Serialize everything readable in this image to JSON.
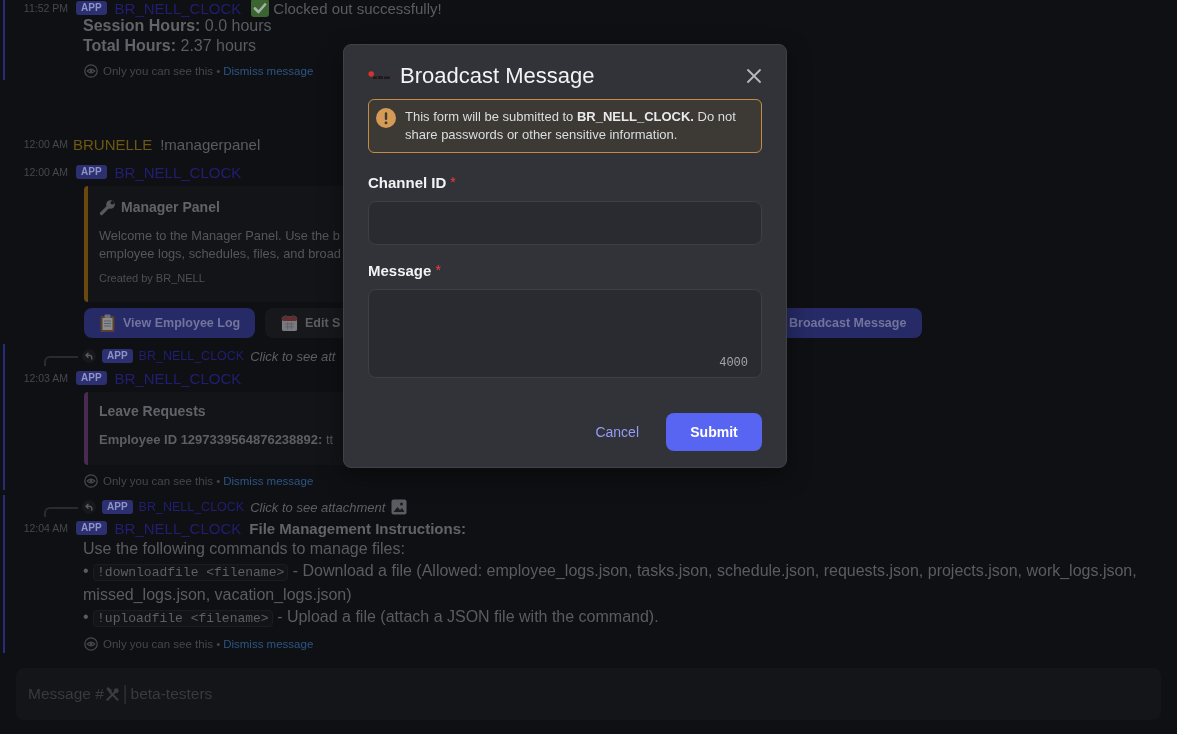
{
  "messages": [
    {
      "kind": "app",
      "ephemeral": true,
      "time": "11:52 PM",
      "badge": "APP",
      "author": "BR_NELL_CLOCK",
      "text": "Clocked out successfully!",
      "lines": [
        {
          "kind": "text",
          "text": "**Session Hours:** 0.0 hours"
        },
        {
          "kind": "text",
          "text": "**Total Hours:** 2.37 hours"
        }
      ],
      "note": {
        "text": "Only you can see this •",
        "link": "Dismiss message"
      }
    },
    {
      "kind": "user",
      "ephemeral": false,
      "time": "12:00 AM",
      "author": "BRUNELLE",
      "text": "!managerpanel"
    },
    {
      "kind": "app",
      "ephemeral": false,
      "time": "12:00 AM",
      "badge": "APP",
      "author": "BR_NELL_CLOCK",
      "embed": {
        "color": "#6b480e",
        "title": "Manager Panel",
        "description": [
          "Welcome to the Manager Panel. Use the b",
          "employee logs, schedules, files, and broad"
        ],
        "footer": "Created by BR_NELL"
      },
      "buttons": [
        {
          "label": "View Employee Log",
          "kind": "primary"
        },
        {
          "label": "Edit S",
          "kind": "secondary"
        },
        {
          "label": "Broadcast Message",
          "kind": "primary"
        }
      ]
    },
    {
      "kind": "app",
      "ephemeral": true,
      "reply": {
        "badge": "APP",
        "author": "BR_NELL_CLOCK",
        "text": "Click to see att"
      },
      "time": "12:03 AM",
      "badge": "APP",
      "author": "BR_NELL_CLOCK",
      "embed": {
        "color": "#4a2953",
        "title": "Leave Requests",
        "fields": [
          "**Employee ID 1297339564876238892:** tt"
        ]
      },
      "note": {
        "text": "Only you can see this •",
        "link": "Dismiss message"
      }
    },
    {
      "kind": "app",
      "ephemeral": true,
      "reply": {
        "badge": "APP",
        "author": "BR_NELL_CLOCK",
        "text": "Click to see attachment"
      },
      "time": "12:04 AM",
      "badge": "APP",
      "author": "BR_NELL_CLOCK",
      "text": "File Management Instructions:",
      "lines": [
        {
          "kind": "text",
          "text": "Use the following commands to manage files:"
        },
        {
          "kind": "command",
          "bullet": "•",
          "code": "!downloadfile <filename>",
          "text": "- Download a file (Allowed: employee_logs.json, tasks.json, schedule.json, requests.json, projects.json, work_logs.json, missed_logs.json, vacation_logs.json)"
        },
        {
          "kind": "command",
          "bullet": "•",
          "code": "!uploadfile <filename>",
          "text": "- Upload a file (attach a JSON file with the command)."
        }
      ],
      "note": {
        "text": "Only you can see this •",
        "link": "Dismiss message"
      }
    }
  ],
  "composer": {
    "placeholder": "Message #",
    "channel": "│beta-testers"
  },
  "modal": {
    "title": "Broadcast Message",
    "notice": "This form will be submitted to **BR_NELL_CLOCK.** Do not share passwords or other sensitive information.",
    "fields": [
      {
        "kind": "short",
        "label": "Channel ID",
        "required_mark": "*"
      },
      {
        "kind": "paragraph",
        "label": "Message",
        "required_mark": "*",
        "counter": "4000"
      }
    ],
    "buttons": [
      {
        "kind": "link",
        "label": "Cancel"
      },
      {
        "kind": "primary",
        "label": "Submit"
      }
    ]
  }
}
